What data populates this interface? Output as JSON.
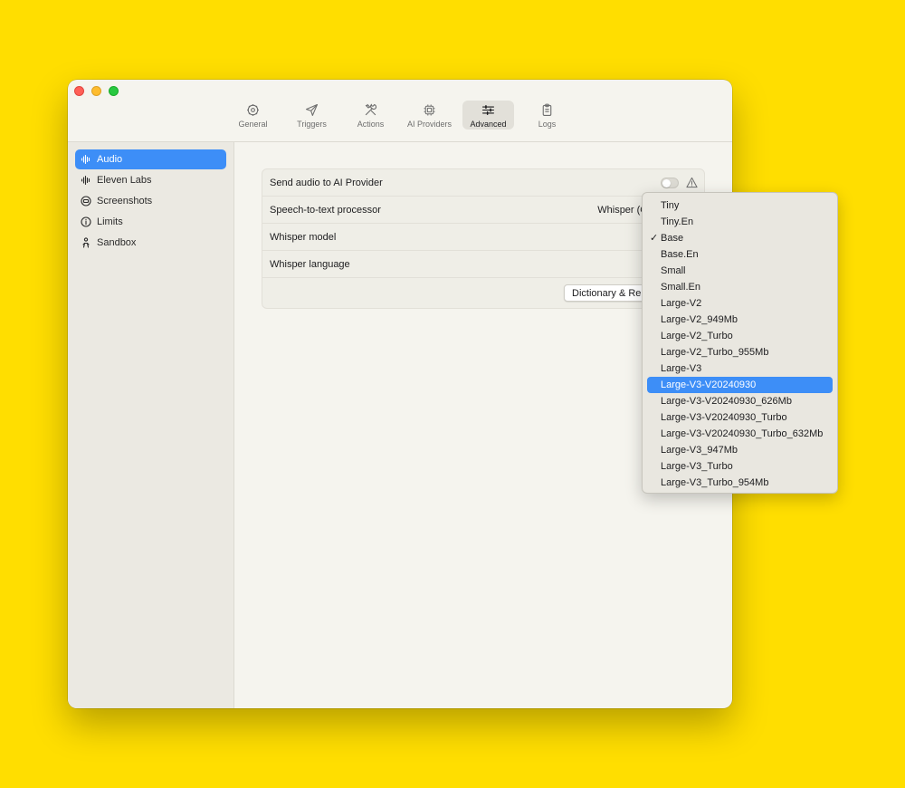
{
  "tabs": [
    {
      "label": "General",
      "icon": "gear-icon"
    },
    {
      "label": "Triggers",
      "icon": "paper-plane-icon"
    },
    {
      "label": "Actions",
      "icon": "tools-icon"
    },
    {
      "label": "AI Providers",
      "icon": "chip-icon"
    },
    {
      "label": "Advanced",
      "icon": "sliders-icon",
      "active": true
    },
    {
      "label": "Logs",
      "icon": "clipboard-icon"
    }
  ],
  "sidebar": {
    "items": [
      {
        "label": "Audio",
        "icon": "waveform-icon",
        "active": true
      },
      {
        "label": "Eleven Labs",
        "icon": "waveform-icon"
      },
      {
        "label": "Screenshots",
        "icon": "screenshot-icon"
      },
      {
        "label": "Limits",
        "icon": "info-icon"
      },
      {
        "label": "Sandbox",
        "icon": "figure-icon"
      }
    ]
  },
  "settings": {
    "send_audio": {
      "label": "Send audio to AI Provider",
      "enabled": false
    },
    "speech_to_text": {
      "label": "Speech-to-text processor",
      "value": "Whisper (On"
    },
    "whisper_model": {
      "label": "Whisper model"
    },
    "whisper_language": {
      "label": "Whisper language"
    },
    "dictionary_button": "Dictionary & Rep"
  },
  "model_menu": {
    "selected": "Base",
    "highlighted": "Large-V3-V20240930",
    "options": [
      "Tiny",
      "Tiny.En",
      "Base",
      "Base.En",
      "Small",
      "Small.En",
      "Large-V2",
      "Large-V2_949Mb",
      "Large-V2_Turbo",
      "Large-V2_Turbo_955Mb",
      "Large-V3",
      "Large-V3-V20240930",
      "Large-V3-V20240930_626Mb",
      "Large-V3-V20240930_Turbo",
      "Large-V3-V20240930_Turbo_632Mb",
      "Large-V3_947Mb",
      "Large-V3_Turbo",
      "Large-V3_Turbo_954Mb"
    ]
  },
  "colors": {
    "background": "#FFDE00",
    "accent": "#3D8EF7"
  }
}
